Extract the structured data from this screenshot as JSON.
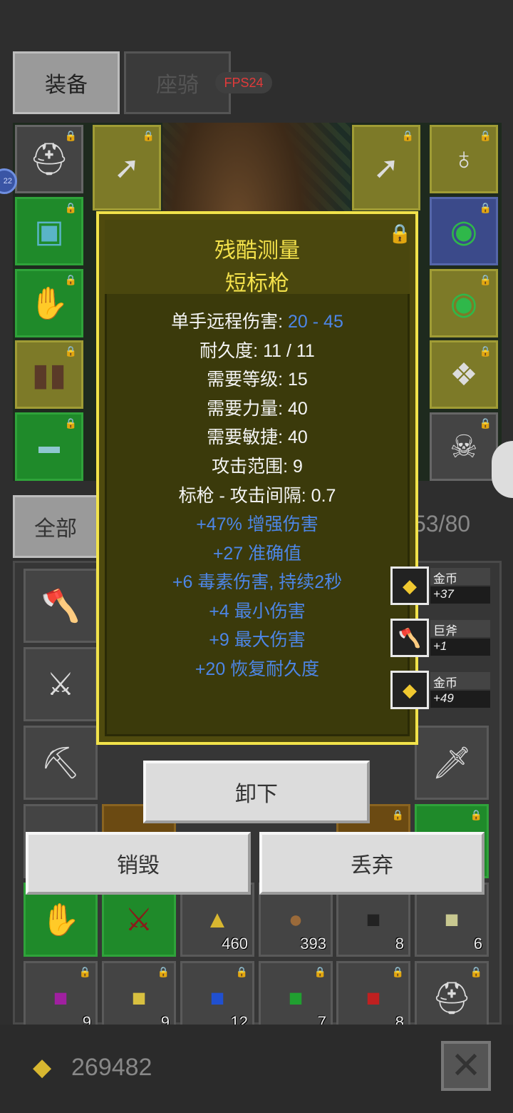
{
  "tabs": {
    "equip": "装备",
    "mount": "座骑",
    "fps": "FPS24",
    "all": "全部"
  },
  "left_badge": "22",
  "capacity": "53/80",
  "tooltip": {
    "title_prefix": "残酷测量",
    "title_item": "短标枪",
    "dmg_label": "单手远程伤害: ",
    "dmg_value": "20 - 45",
    "stats": [
      "耐久度: 11 / 11",
      "需要等级: 15",
      "需要力量: 40",
      "需要敏捷: 40",
      "攻击范围: 9",
      "标枪 - 攻击间隔: 0.7"
    ],
    "bonuses": [
      "+47% 增强伤害",
      "+27 准确值",
      "+6 毒素伤害, 持续2秒",
      "+4 最小伤害",
      "+9 最大伤害",
      "+20 恢复耐久度"
    ]
  },
  "pickups": [
    {
      "name": "金币",
      "count": "+37",
      "icon": "gold-coins-icon"
    },
    {
      "name": "巨斧",
      "count": "+1",
      "icon": "great-axe-icon"
    },
    {
      "name": "金币",
      "count": "+49",
      "icon": "gold-coins-icon"
    }
  ],
  "inventory_counts": [
    "460",
    "393",
    "8",
    "6",
    "9",
    "9",
    "12",
    "7",
    "8"
  ],
  "buttons": {
    "unequip": "卸下",
    "destroy": "销毁",
    "drop": "丢弃"
  },
  "gold": "269482",
  "close_glyph": "✕",
  "colors": {
    "tooltip_border": "#f2e34a",
    "tooltip_title": "#f3e14b",
    "bonus_blue": "#4d86e6"
  }
}
